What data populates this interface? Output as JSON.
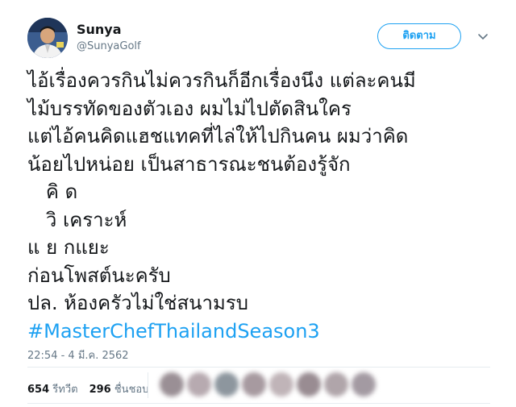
{
  "user": {
    "display_name": "Sunya",
    "handle": "@SunyaGolf"
  },
  "follow_button": {
    "label": "ติดตาม"
  },
  "tweet": {
    "lines": [
      "ไอ้เรื่องควรกินไม่ควรกินก็อีกเรื่องนึง แต่ละคนมี",
      "ไม้บรรทัดของตัวเอง ผมไม่ไปตัดสินใคร",
      "แต่ไอ้คนคิดแฮชแทคที่ไล่ให้ไปกินคน ผมว่าคิด",
      "น้อยไปหน่อย เป็นสาธารณะชนต้องรู้จัก",
      "   คิ ด",
      "   วิ เคราะห์",
      "แ ย กแยะ",
      "ก่อนโพสต์นะครับ",
      "ปล. ห้องครัวไม่ใช่สนามรบ"
    ],
    "hashtag": "#MasterChefThailandSeason3",
    "timestamp": "22:54 - 4 มี.ค. 2562"
  },
  "stats": {
    "retweets_count": "654",
    "retweets_label": "รีทวีต",
    "likes_count": "296",
    "likes_label": "ชื่นชอบ"
  },
  "colors": {
    "accent": "#1da1f2",
    "text": "#14171a",
    "muted": "#657786"
  }
}
